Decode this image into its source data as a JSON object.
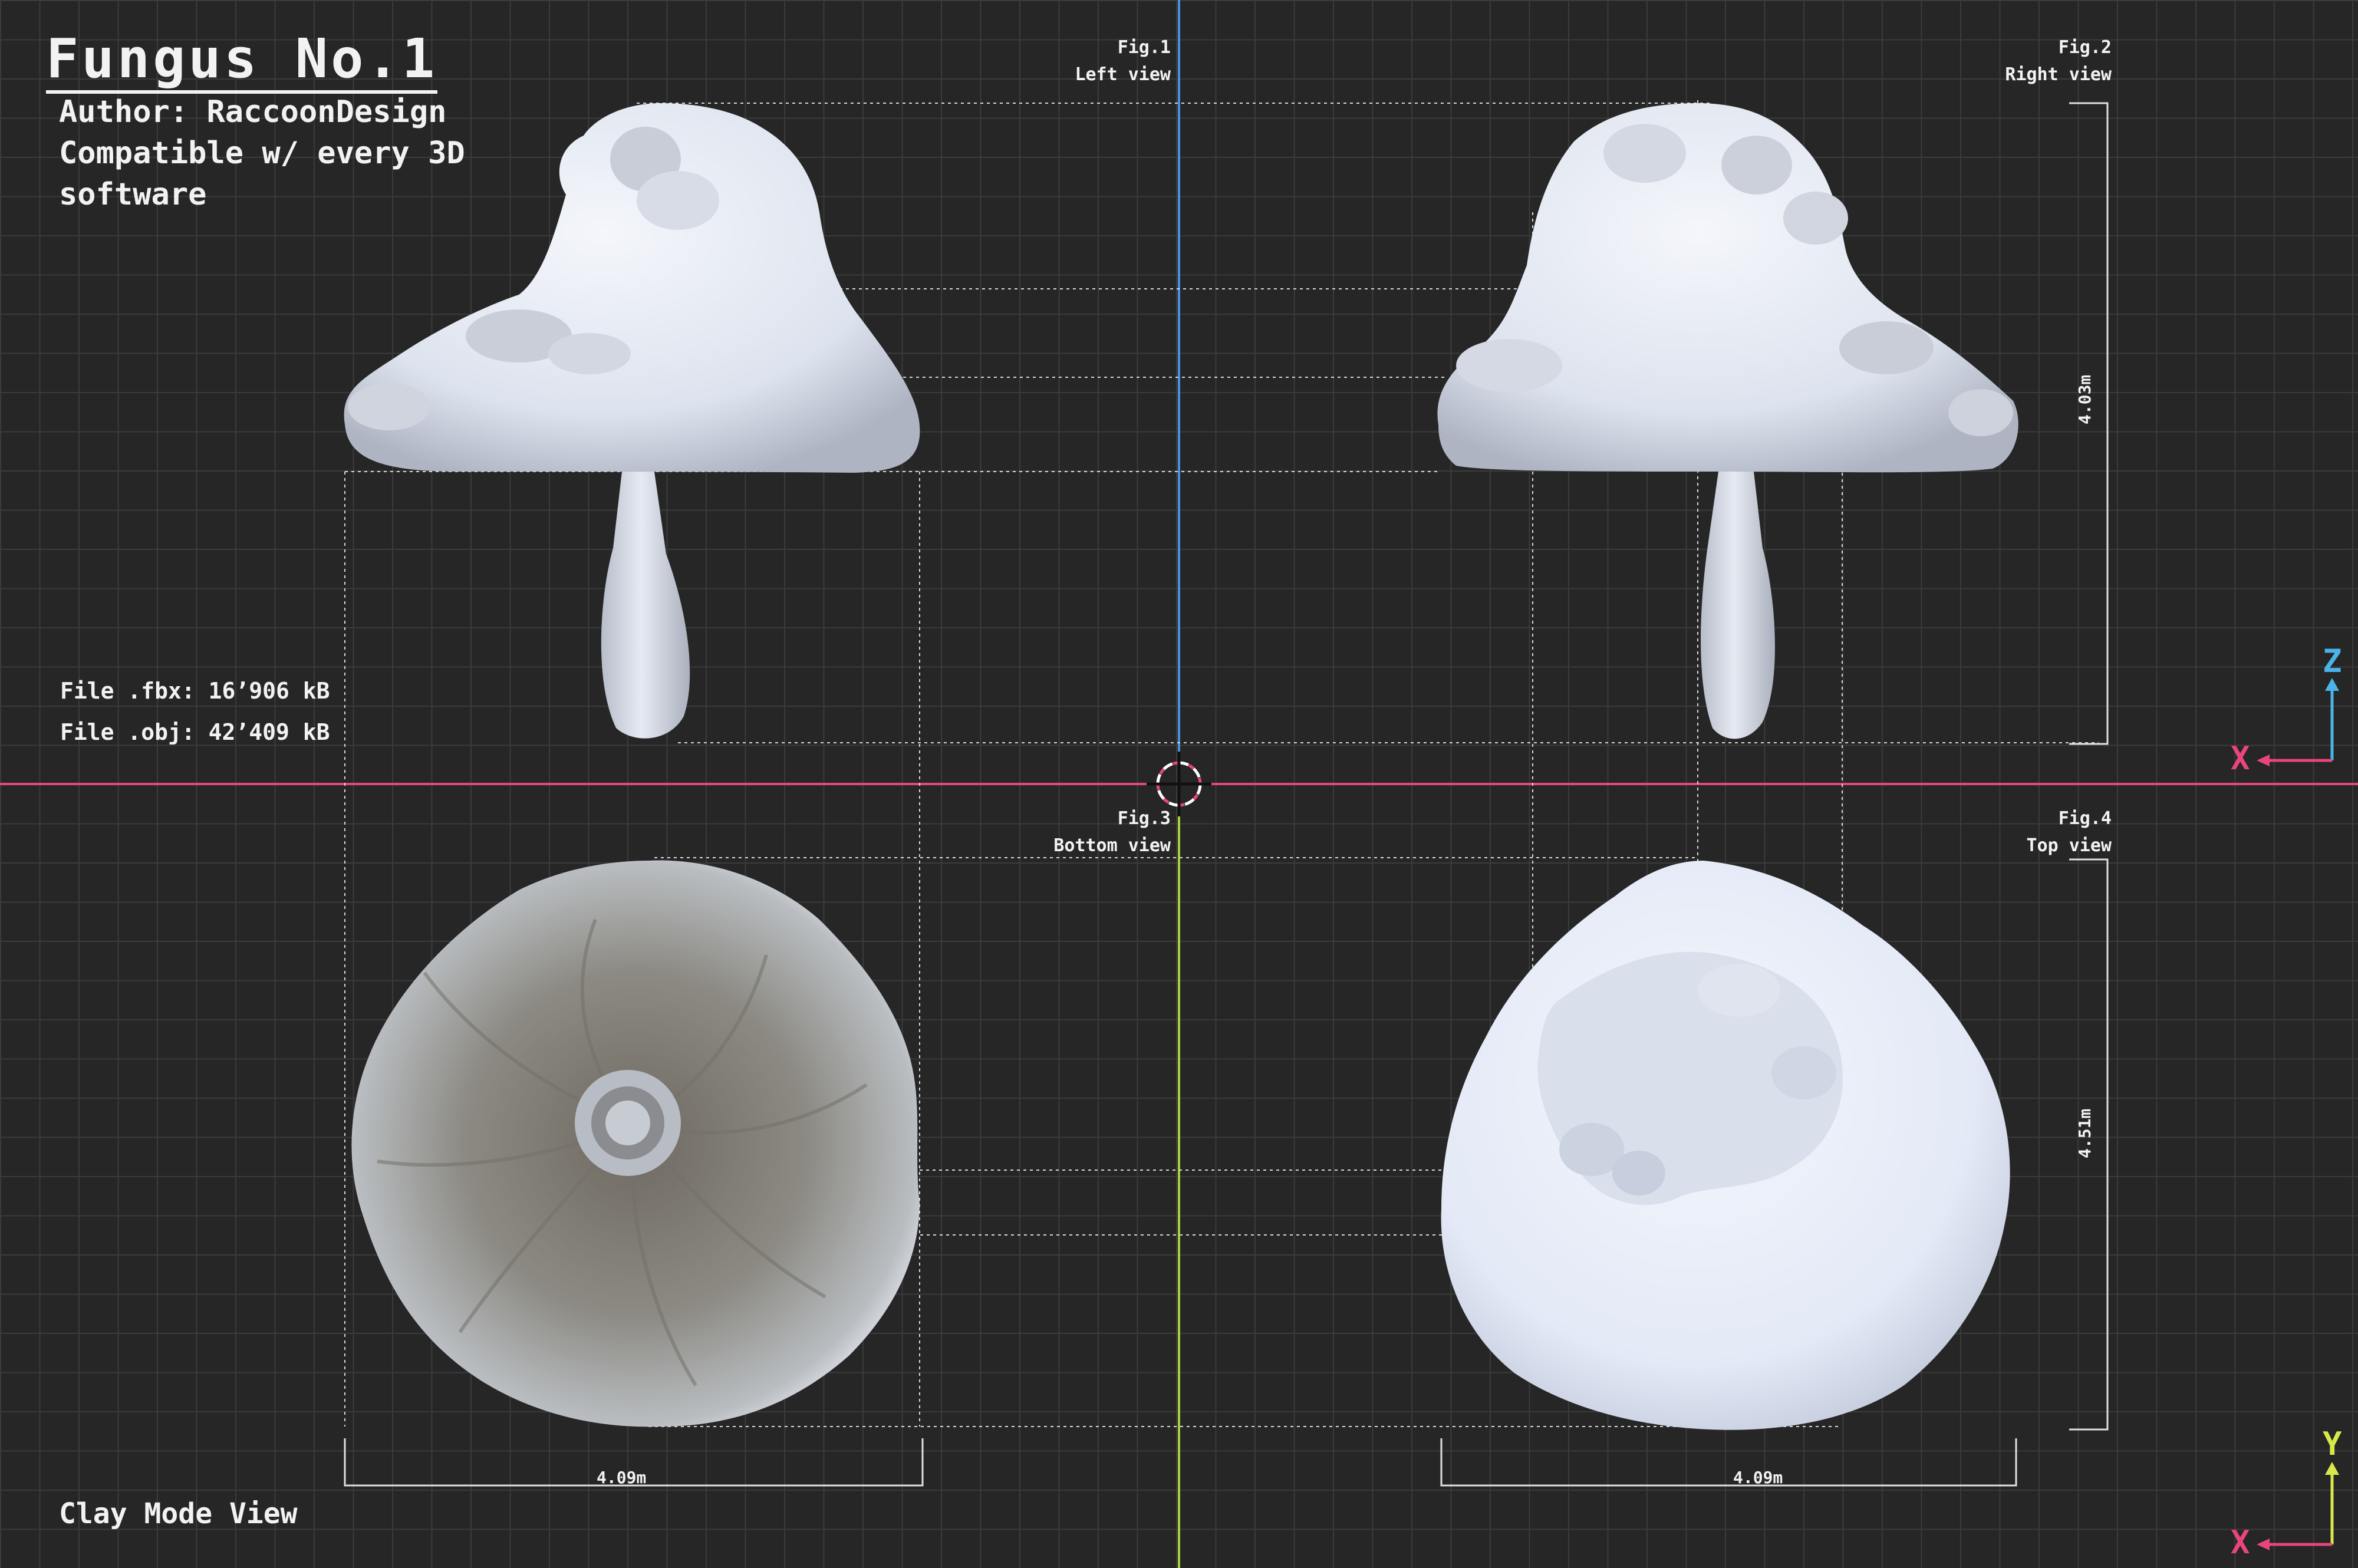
{
  "header": {
    "title": "Fungus No.1",
    "author": "Author: RaccoonDesign",
    "compat_line1": "Compatible w/ every 3D",
    "compat_line2": "software"
  },
  "files": {
    "fbx": "File .fbx: 16’906 kB",
    "obj": "File .obj: 42’409 kB"
  },
  "figures": {
    "fig1": {
      "label": "Fig.1",
      "view": "Left view"
    },
    "fig2": {
      "label": "Fig.2",
      "view": "Right view"
    },
    "fig3": {
      "label": "Fig.3",
      "view": "Bottom view"
    },
    "fig4": {
      "label": "Fig.4",
      "view": "Top view"
    }
  },
  "dimensions": {
    "height_side": "4.03m",
    "height_top": "4.51m",
    "width_bottom": "4.09m",
    "width_top": "4.09m"
  },
  "axes": {
    "upper_vertical": "Z",
    "upper_horizontal": "X",
    "lower_vertical": "Y",
    "lower_horizontal": "X"
  },
  "footer": {
    "mode": "Clay Mode View"
  },
  "colors": {
    "background": "#262626",
    "grid": "#3b3b3b",
    "axis_red": "#e8457c",
    "axis_blue": "#4a90e2",
    "axis_green": "#a4d23a",
    "z_icon": "#4ab3e8",
    "y_icon": "#d6e84a",
    "x_icon": "#e8457c",
    "clay_light": "#e9edf5",
    "clay_bottom": "#8f8f88"
  }
}
